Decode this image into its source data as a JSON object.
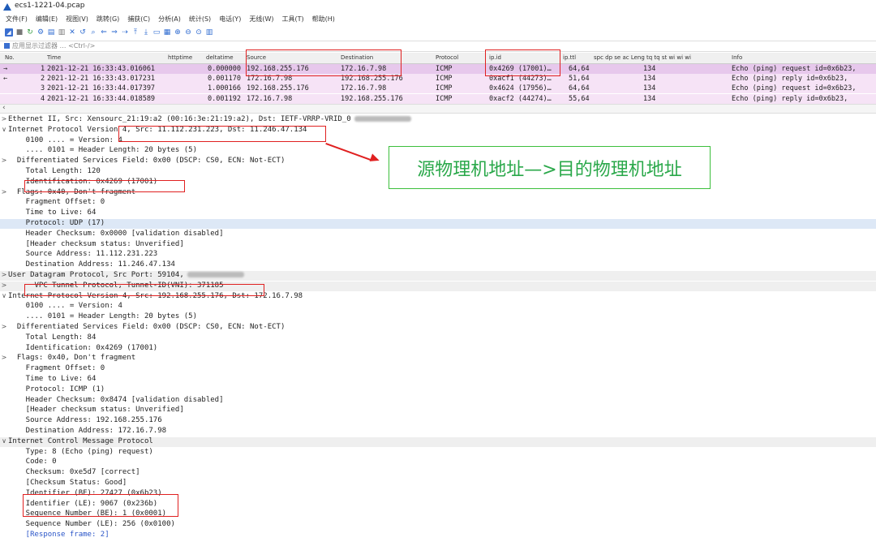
{
  "window": {
    "title": "ecs1-1221-04.pcap"
  },
  "menu": [
    "文件(F)",
    "编辑(E)",
    "视图(V)",
    "跳转(G)",
    "捕获(C)",
    "分析(A)",
    "统计(S)",
    "电话(Y)",
    "无线(W)",
    "工具(T)",
    "帮助(H)"
  ],
  "filter": {
    "placeholder": "应用显示过滤器 … <Ctrl-/>"
  },
  "columns": {
    "no": "No.",
    "time": "Time",
    "httptime": "httptime",
    "deltatime": "deltatime",
    "source": "Source",
    "destination": "Destination",
    "protocol": "Protocol",
    "ipid": "ip.id",
    "ipttl": "ip.ttl",
    "extra": "spc dp se ac Leng tq tq st wi wi wi",
    "info": "Info"
  },
  "packets": [
    {
      "no": "1",
      "time": "2021-12-21 16:33:43.016061",
      "delta": "0.000000",
      "src": "192.168.255.176",
      "dst": "172.16.7.98",
      "proto": "ICMP",
      "ipid": "0x4269 (17001)…",
      "ttl": "64,64",
      "len": "134",
      "info": "Echo (ping) request  id=0x6b23,",
      "marker": "→"
    },
    {
      "no": "2",
      "time": "2021-12-21 16:33:43.017231",
      "delta": "0.001170",
      "src": "172.16.7.98",
      "dst": "192.168.255.176",
      "proto": "ICMP",
      "ipid": "0xacf1 (44273)…",
      "ttl": "51,64",
      "len": "134",
      "info": "Echo (ping) reply    id=0x6b23,",
      "marker": "←"
    },
    {
      "no": "3",
      "time": "2021-12-21 16:33:44.017397",
      "delta": "1.000166",
      "src": "192.168.255.176",
      "dst": "172.16.7.98",
      "proto": "ICMP",
      "ipid": "0x4624 (17956)…",
      "ttl": "64,64",
      "len": "134",
      "info": "Echo (ping) request  id=0x6b23,",
      "marker": ""
    },
    {
      "no": "4",
      "time": "2021-12-21 16:33:44.018589",
      "delta": "0.001192",
      "src": "172.16.7.98",
      "dst": "192.168.255.176",
      "proto": "ICMP",
      "ipid": "0xacf2 (44274)…",
      "ttl": "55,64",
      "len": "134",
      "info": "Echo (ping) reply    id=0x6b23,",
      "marker": ""
    }
  ],
  "details": [
    {
      "exp": ">",
      "text": "Ethernet II, Src: Xensourc_21:19:a2 (00:16:3e:21:19:a2), Dst: IETF-VRRP-VRID_0",
      "sec": false
    },
    {
      "exp": "∨",
      "text": "Internet Protocol Version 4, Src: 11.112.231.223, Dst: 11.246.47.134",
      "sec": false
    },
    {
      "exp": "",
      "text": "    0100 .... = Version: 4",
      "sec": false
    },
    {
      "exp": "",
      "text": "    .... 0101 = Header Length: 20 bytes (5)",
      "sec": false
    },
    {
      "exp": ">",
      "text": "  Differentiated Services Field: 0x00 (DSCP: CS0, ECN: Not-ECT)",
      "sec": false
    },
    {
      "exp": "",
      "text": "    Total Length: 120",
      "sec": false
    },
    {
      "exp": "",
      "text": "    Identification: 0x4269 (17001)",
      "sec": false
    },
    {
      "exp": ">",
      "text": "  Flags: 0x40, Don't fragment",
      "sec": false
    },
    {
      "exp": "",
      "text": "    Fragment Offset: 0",
      "sec": false
    },
    {
      "exp": "",
      "text": "    Time to Live: 64",
      "sec": false
    },
    {
      "exp": "",
      "text": "    Protocol: UDP (17)",
      "sec": false,
      "hl": true
    },
    {
      "exp": "",
      "text": "    Header Checksum: 0x0000 [validation disabled]",
      "sec": false
    },
    {
      "exp": "",
      "text": "    [Header checksum status: Unverified]",
      "sec": false
    },
    {
      "exp": "",
      "text": "    Source Address: 11.112.231.223",
      "sec": false
    },
    {
      "exp": "",
      "text": "    Destination Address: 11.246.47.134",
      "sec": false
    },
    {
      "exp": ">",
      "text": "User Datagram Protocol, Src Port: 59104,",
      "sec": true
    },
    {
      "exp": ">",
      "text": "      VPC Tunnel Protocol, Tunnel-ID(VNI): 371185",
      "sec": true
    },
    {
      "exp": "∨",
      "text": "Internet Protocol Version 4, Src: 192.168.255.176, Dst: 172.16.7.98",
      "sec": false
    },
    {
      "exp": "",
      "text": "    0100 .... = Version: 4",
      "sec": false
    },
    {
      "exp": "",
      "text": "    .... 0101 = Header Length: 20 bytes (5)",
      "sec": false
    },
    {
      "exp": ">",
      "text": "  Differentiated Services Field: 0x00 (DSCP: CS0, ECN: Not-ECT)",
      "sec": false
    },
    {
      "exp": "",
      "text": "    Total Length: 84",
      "sec": false
    },
    {
      "exp": "",
      "text": "    Identification: 0x4269 (17001)",
      "sec": false
    },
    {
      "exp": ">",
      "text": "  Flags: 0x40, Don't fragment",
      "sec": false
    },
    {
      "exp": "",
      "text": "    Fragment Offset: 0",
      "sec": false
    },
    {
      "exp": "",
      "text": "    Time to Live: 64",
      "sec": false
    },
    {
      "exp": "",
      "text": "    Protocol: ICMP (1)",
      "sec": false
    },
    {
      "exp": "",
      "text": "    Header Checksum: 0x8474 [validation disabled]",
      "sec": false
    },
    {
      "exp": "",
      "text": "    [Header checksum status: Unverified]",
      "sec": false
    },
    {
      "exp": "",
      "text": "    Source Address: 192.168.255.176",
      "sec": false
    },
    {
      "exp": "",
      "text": "    Destination Address: 172.16.7.98",
      "sec": false
    },
    {
      "exp": "∨",
      "text": "Internet Control Message Protocol",
      "sec": true
    },
    {
      "exp": "",
      "text": "    Type: 8 (Echo (ping) request)",
      "sec": false
    },
    {
      "exp": "",
      "text": "    Code: 0",
      "sec": false
    },
    {
      "exp": "",
      "text": "    Checksum: 0xe5d7 [correct]",
      "sec": false
    },
    {
      "exp": "",
      "text": "    [Checksum Status: Good]",
      "sec": false
    },
    {
      "exp": "",
      "text": "    Identifier (BE): 27427 (0x6b23)",
      "sec": false
    },
    {
      "exp": "",
      "text": "    Identifier (LE): 9067 (0x236b)",
      "sec": false
    },
    {
      "exp": "",
      "text": "    Sequence Number (BE): 1 (0x0001)",
      "sec": false
    },
    {
      "exp": "",
      "text": "    Sequence Number (LE): 256 (0x0100)",
      "sec": false
    },
    {
      "exp": "",
      "text": "    [Response frame: 2]",
      "sec": false,
      "link": true
    }
  ],
  "annotation": {
    "text": "源物理机地址—>目的物理机地址"
  },
  "colors": {
    "packet_row": "#f6e3f6",
    "red_box": "#e02020",
    "annotation": "#2aa84a"
  }
}
